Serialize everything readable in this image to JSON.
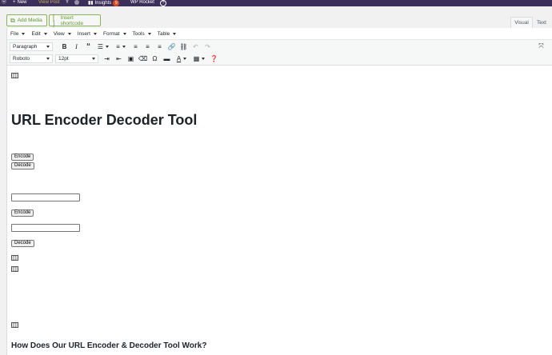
{
  "admin_bar": {
    "items": [
      "New",
      "View Post",
      "Insights",
      "WP Rocket"
    ],
    "insights_badge": "9",
    "icons": [
      "wp-logo-icon",
      "plus-icon",
      "yoast-icon",
      "status-dot-icon",
      "bar-chart-icon",
      "help-icon"
    ]
  },
  "media_buttons": {
    "add_media": "Add Media",
    "insert_shortcode": "Insert shortcode"
  },
  "editor_tabs": {
    "visual": "Visual",
    "text": "Text",
    "active": "Visual"
  },
  "menubar": [
    "File",
    "Edit",
    "View",
    "Insert",
    "Format",
    "Tools",
    "Table"
  ],
  "toolbar1": {
    "format_select": "Paragraph",
    "icons": [
      "bold-icon",
      "italic-icon",
      "blockquote-icon",
      "bulleted-list-icon",
      "numbered-list-icon",
      "align-left-icon",
      "align-center-icon",
      "align-right-icon",
      "link-icon",
      "unlink-icon",
      "undo-icon",
      "redo-icon",
      "fullscreen-icon"
    ]
  },
  "toolbar2": {
    "font_family": "Roboto",
    "font_size": "12pt",
    "icons": [
      "indent-icon",
      "outdent-icon",
      "paste-text-icon",
      "clear-formatting-icon",
      "special-character-icon",
      "horizontal-rule-icon",
      "text-color-icon",
      "table-icon",
      "help-icon"
    ]
  },
  "content": {
    "title": "URL Encoder Decoder Tool",
    "encode_label": "Encode",
    "decode_label": "Decode",
    "subheading": "How Does Our URL Encoder & Decoder Tool Work?",
    "shortcode_icon_glyph": "[ ]"
  },
  "colors": {
    "admin_bar": "#3c2f5a",
    "accent_green": "#5b9a2c",
    "badge": "#d54e21"
  }
}
